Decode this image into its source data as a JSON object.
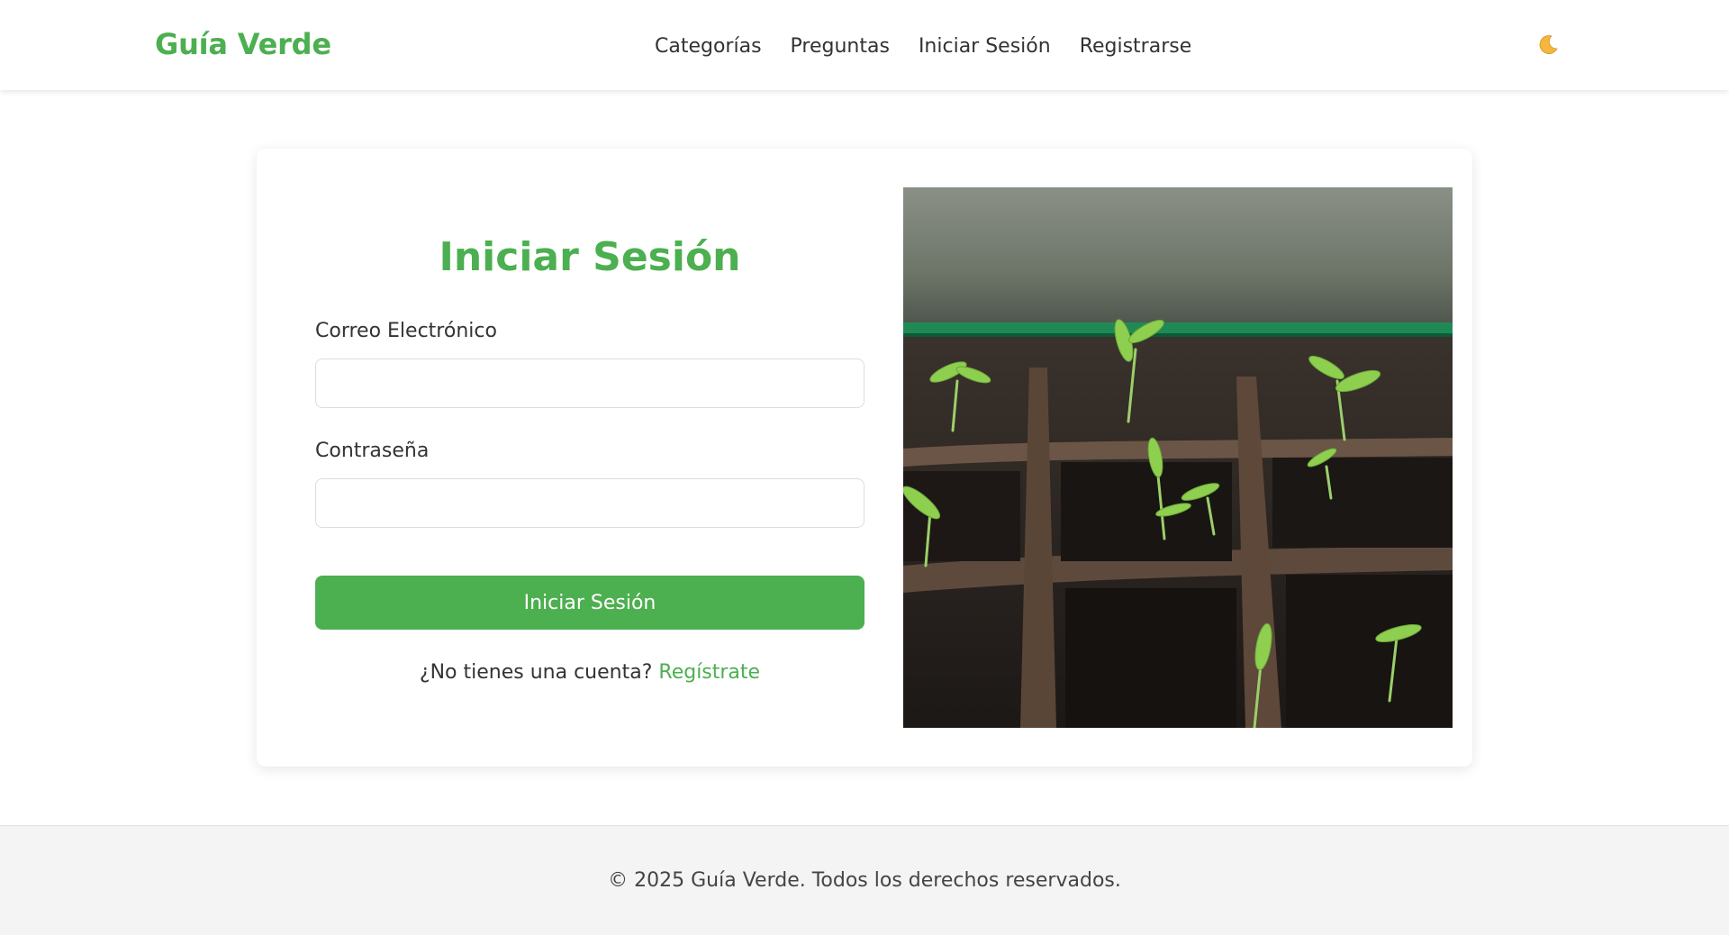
{
  "header": {
    "logo": "Guía Verde",
    "nav": {
      "categories": "Categorías",
      "questions": "Preguntas",
      "login": "Iniciar Sesión",
      "register": "Registrarse"
    },
    "theme_toggle_icon": "moon-icon"
  },
  "login_form": {
    "title": "Iniciar Sesión",
    "email_label": "Correo Electrónico",
    "email_value": "",
    "password_label": "Contraseña",
    "password_value": "",
    "submit_label": "Iniciar Sesión",
    "register_prompt": "¿No tienes una cuenta?",
    "register_link": "Regístrate"
  },
  "hero_image": {
    "subject": "seedlings-in-seed-tray"
  },
  "footer": {
    "copyright": "© 2025 Guía Verde. Todos los derechos reservados."
  },
  "colors": {
    "brand_green": "#4caf50",
    "text": "#333333",
    "footer_bg": "#f4f4f4"
  }
}
